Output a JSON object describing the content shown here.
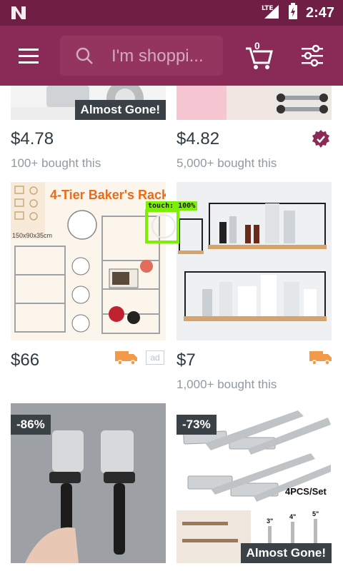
{
  "status": {
    "time": "2:47",
    "network": "LTE"
  },
  "search": {
    "placeholder": "I'm shoppi..."
  },
  "cart": {
    "count": "0"
  },
  "colors": {
    "brand": "#8a2a56",
    "status_bar": "#6e1f43",
    "price": "#2f3a40",
    "muted": "#8f9aa0",
    "shipping": "#f2994a",
    "verified": "#8a2a56"
  },
  "products": [
    {
      "price": "$4.78",
      "bought": "100+ bought this",
      "badge": "Almost Gone!"
    },
    {
      "price": "$4.82",
      "bought": "5,000+ bought this",
      "verified_icon": "check-badge-icon"
    },
    {
      "price": "$66",
      "ad": "ad",
      "image_text": "4-Tier Baker's Rack",
      "image_dims": "150x90x35cm",
      "shipping_icon": "truck-icon"
    },
    {
      "price": "$7",
      "bought": "1,000+ bought this",
      "shipping_icon": "truck-icon"
    },
    {
      "discount": "-86%"
    },
    {
      "discount": "-73%",
      "badge": "Almost Gone!",
      "image_text": "4PCS/Set",
      "sizes": [
        "3\"",
        "4\"",
        "5\""
      ]
    }
  ],
  "overlay": {
    "touch_label": "touch: 100%"
  }
}
